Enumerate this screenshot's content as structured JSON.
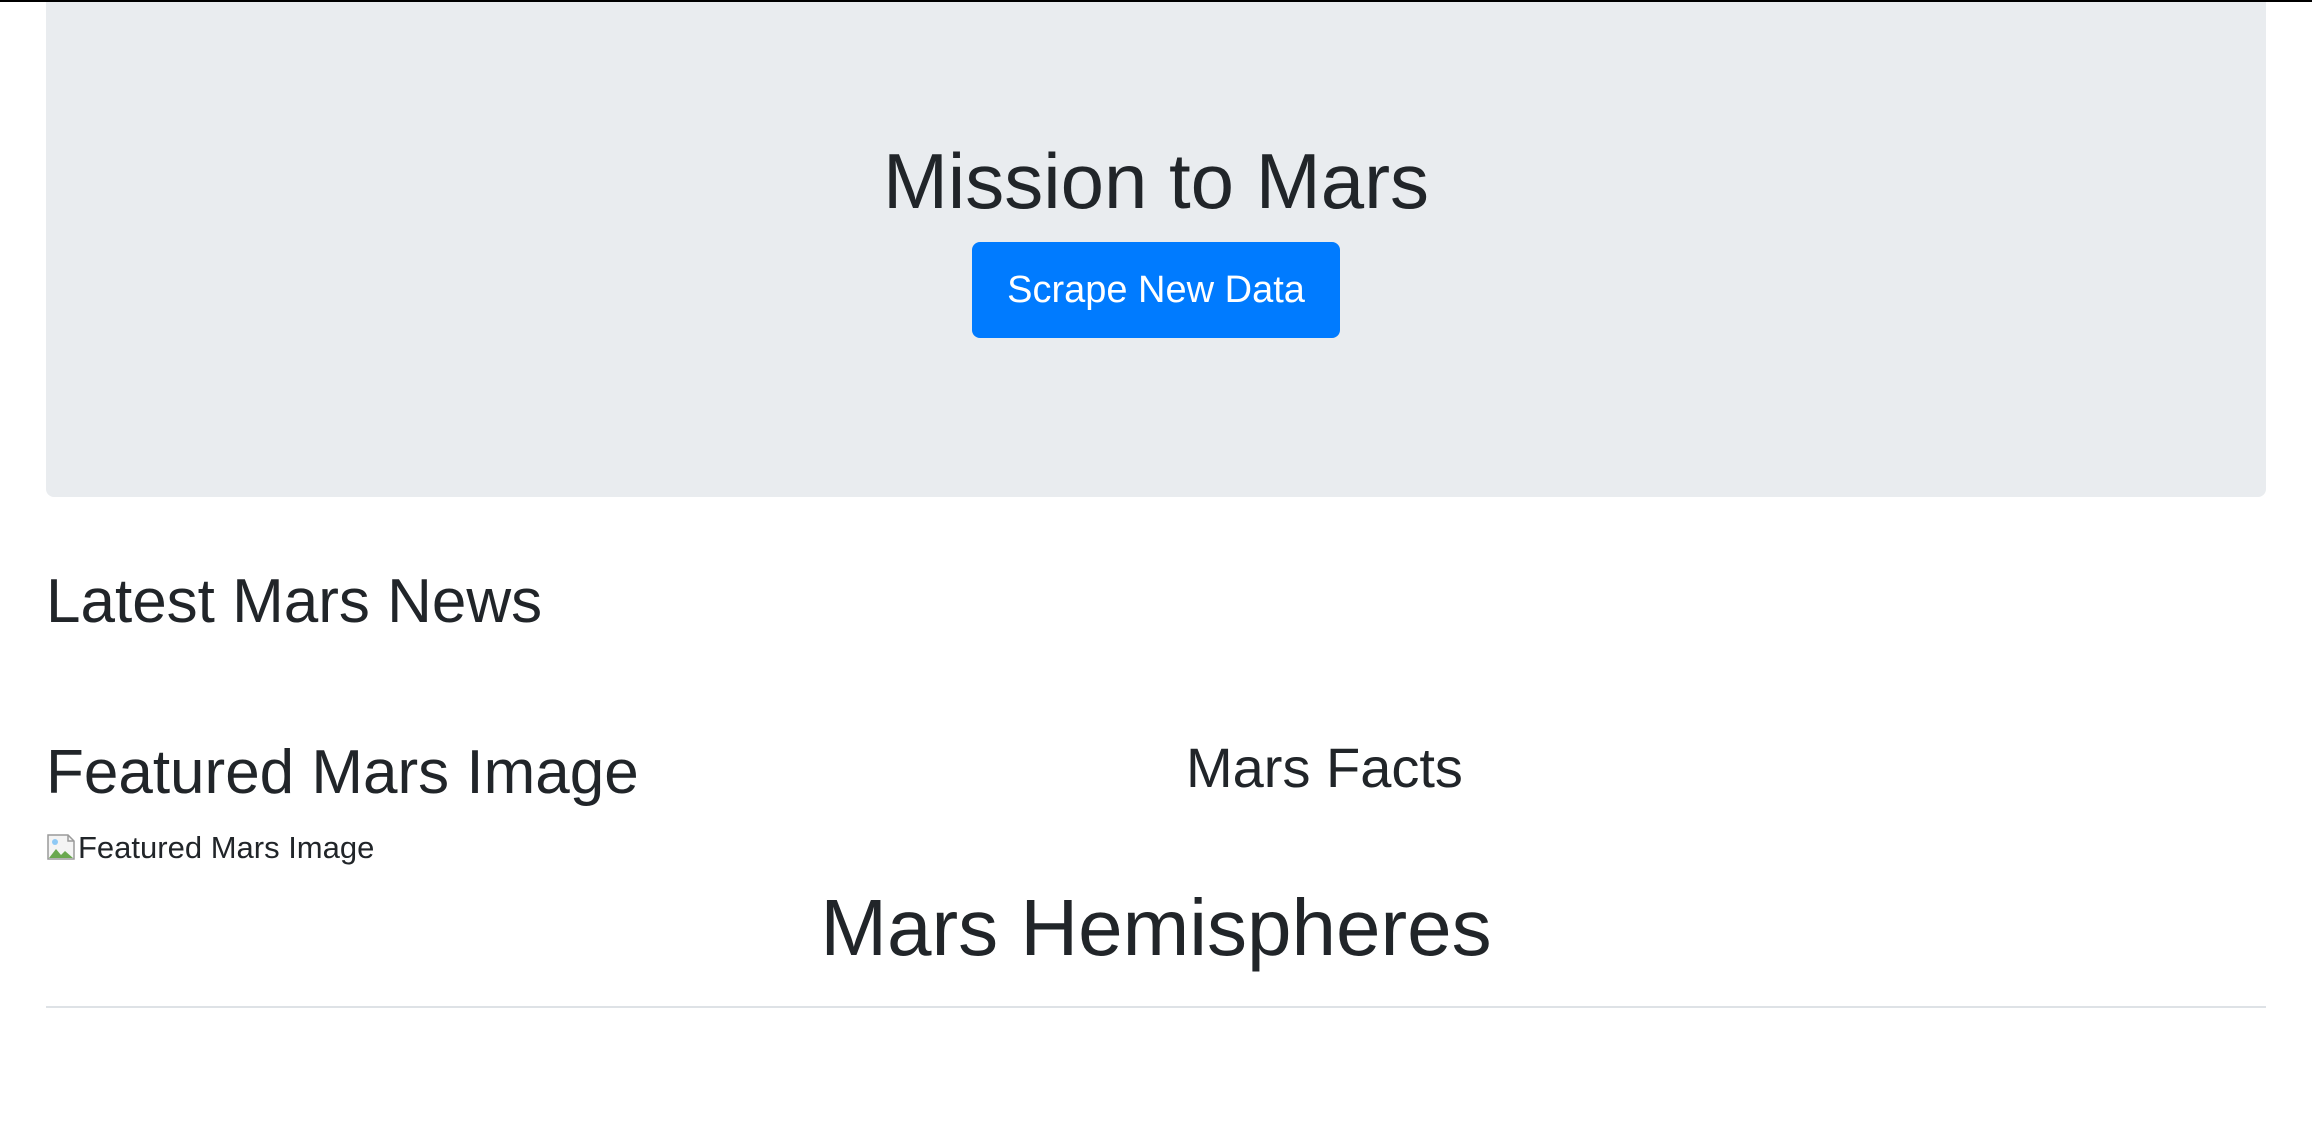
{
  "header": {
    "title": "Mission to Mars",
    "scrape_button_label": "Scrape New Data"
  },
  "sections": {
    "news_title": "Latest Mars News",
    "featured_image_title": "Featured Mars Image",
    "featured_image_alt": "Featured Mars Image",
    "facts_title": "Mars Facts",
    "hemispheres_title": "Mars Hemispheres"
  },
  "colors": {
    "jumbotron_bg": "#e9ecef",
    "primary_button": "#007bff",
    "text": "#212529"
  },
  "icons": {
    "broken_image": "broken-image-icon"
  }
}
